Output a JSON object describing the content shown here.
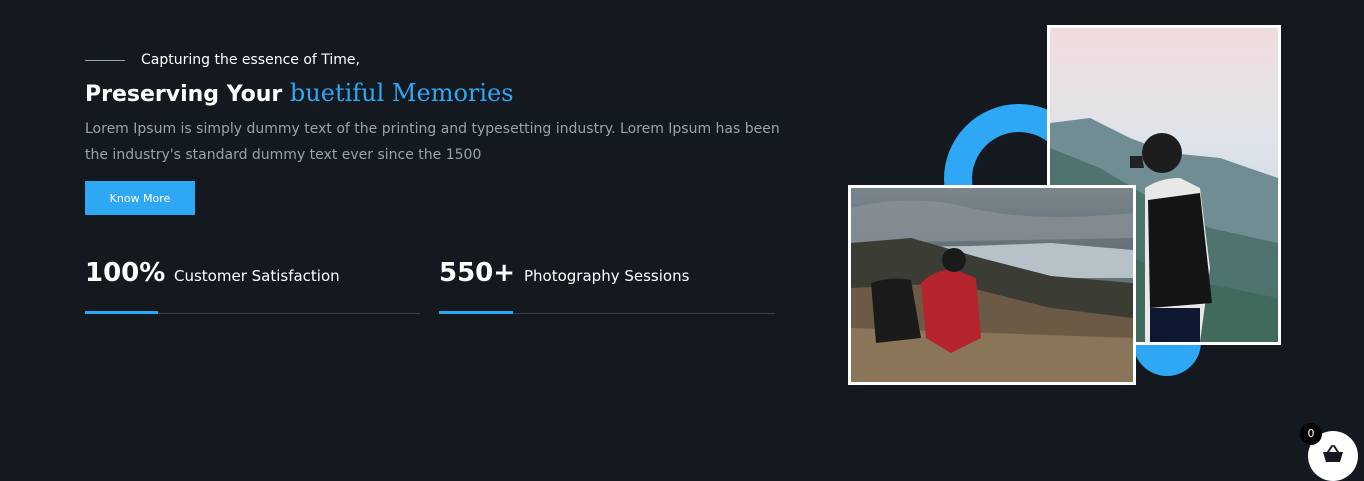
{
  "hero": {
    "eyebrow": "Capturing the essence of Time,",
    "headline_plain": "Preserving Your ",
    "headline_accent": "buetiful Memories",
    "description": "Lorem Ipsum is simply dummy text of the printing and typesetting industry. Lorem Ipsum has been the industry's standard dummy text ever since the 1500",
    "cta_label": "Know More"
  },
  "stats": [
    {
      "value": "100%",
      "label": "Customer Satisfaction"
    },
    {
      "value": "550+",
      "label": "Photography Sessions"
    }
  ],
  "gallery": {
    "photo_a_alt": "hiker-with-camera-on-mountain",
    "photo_b_alt": "photographer-in-red-jacket-on-hillside"
  },
  "cart": {
    "count": "0",
    "icon": "basket-icon"
  },
  "colors": {
    "background": "#141920",
    "accent": "#2ea7f5",
    "text": "#ffffff",
    "muted": "#9aa3ad"
  }
}
